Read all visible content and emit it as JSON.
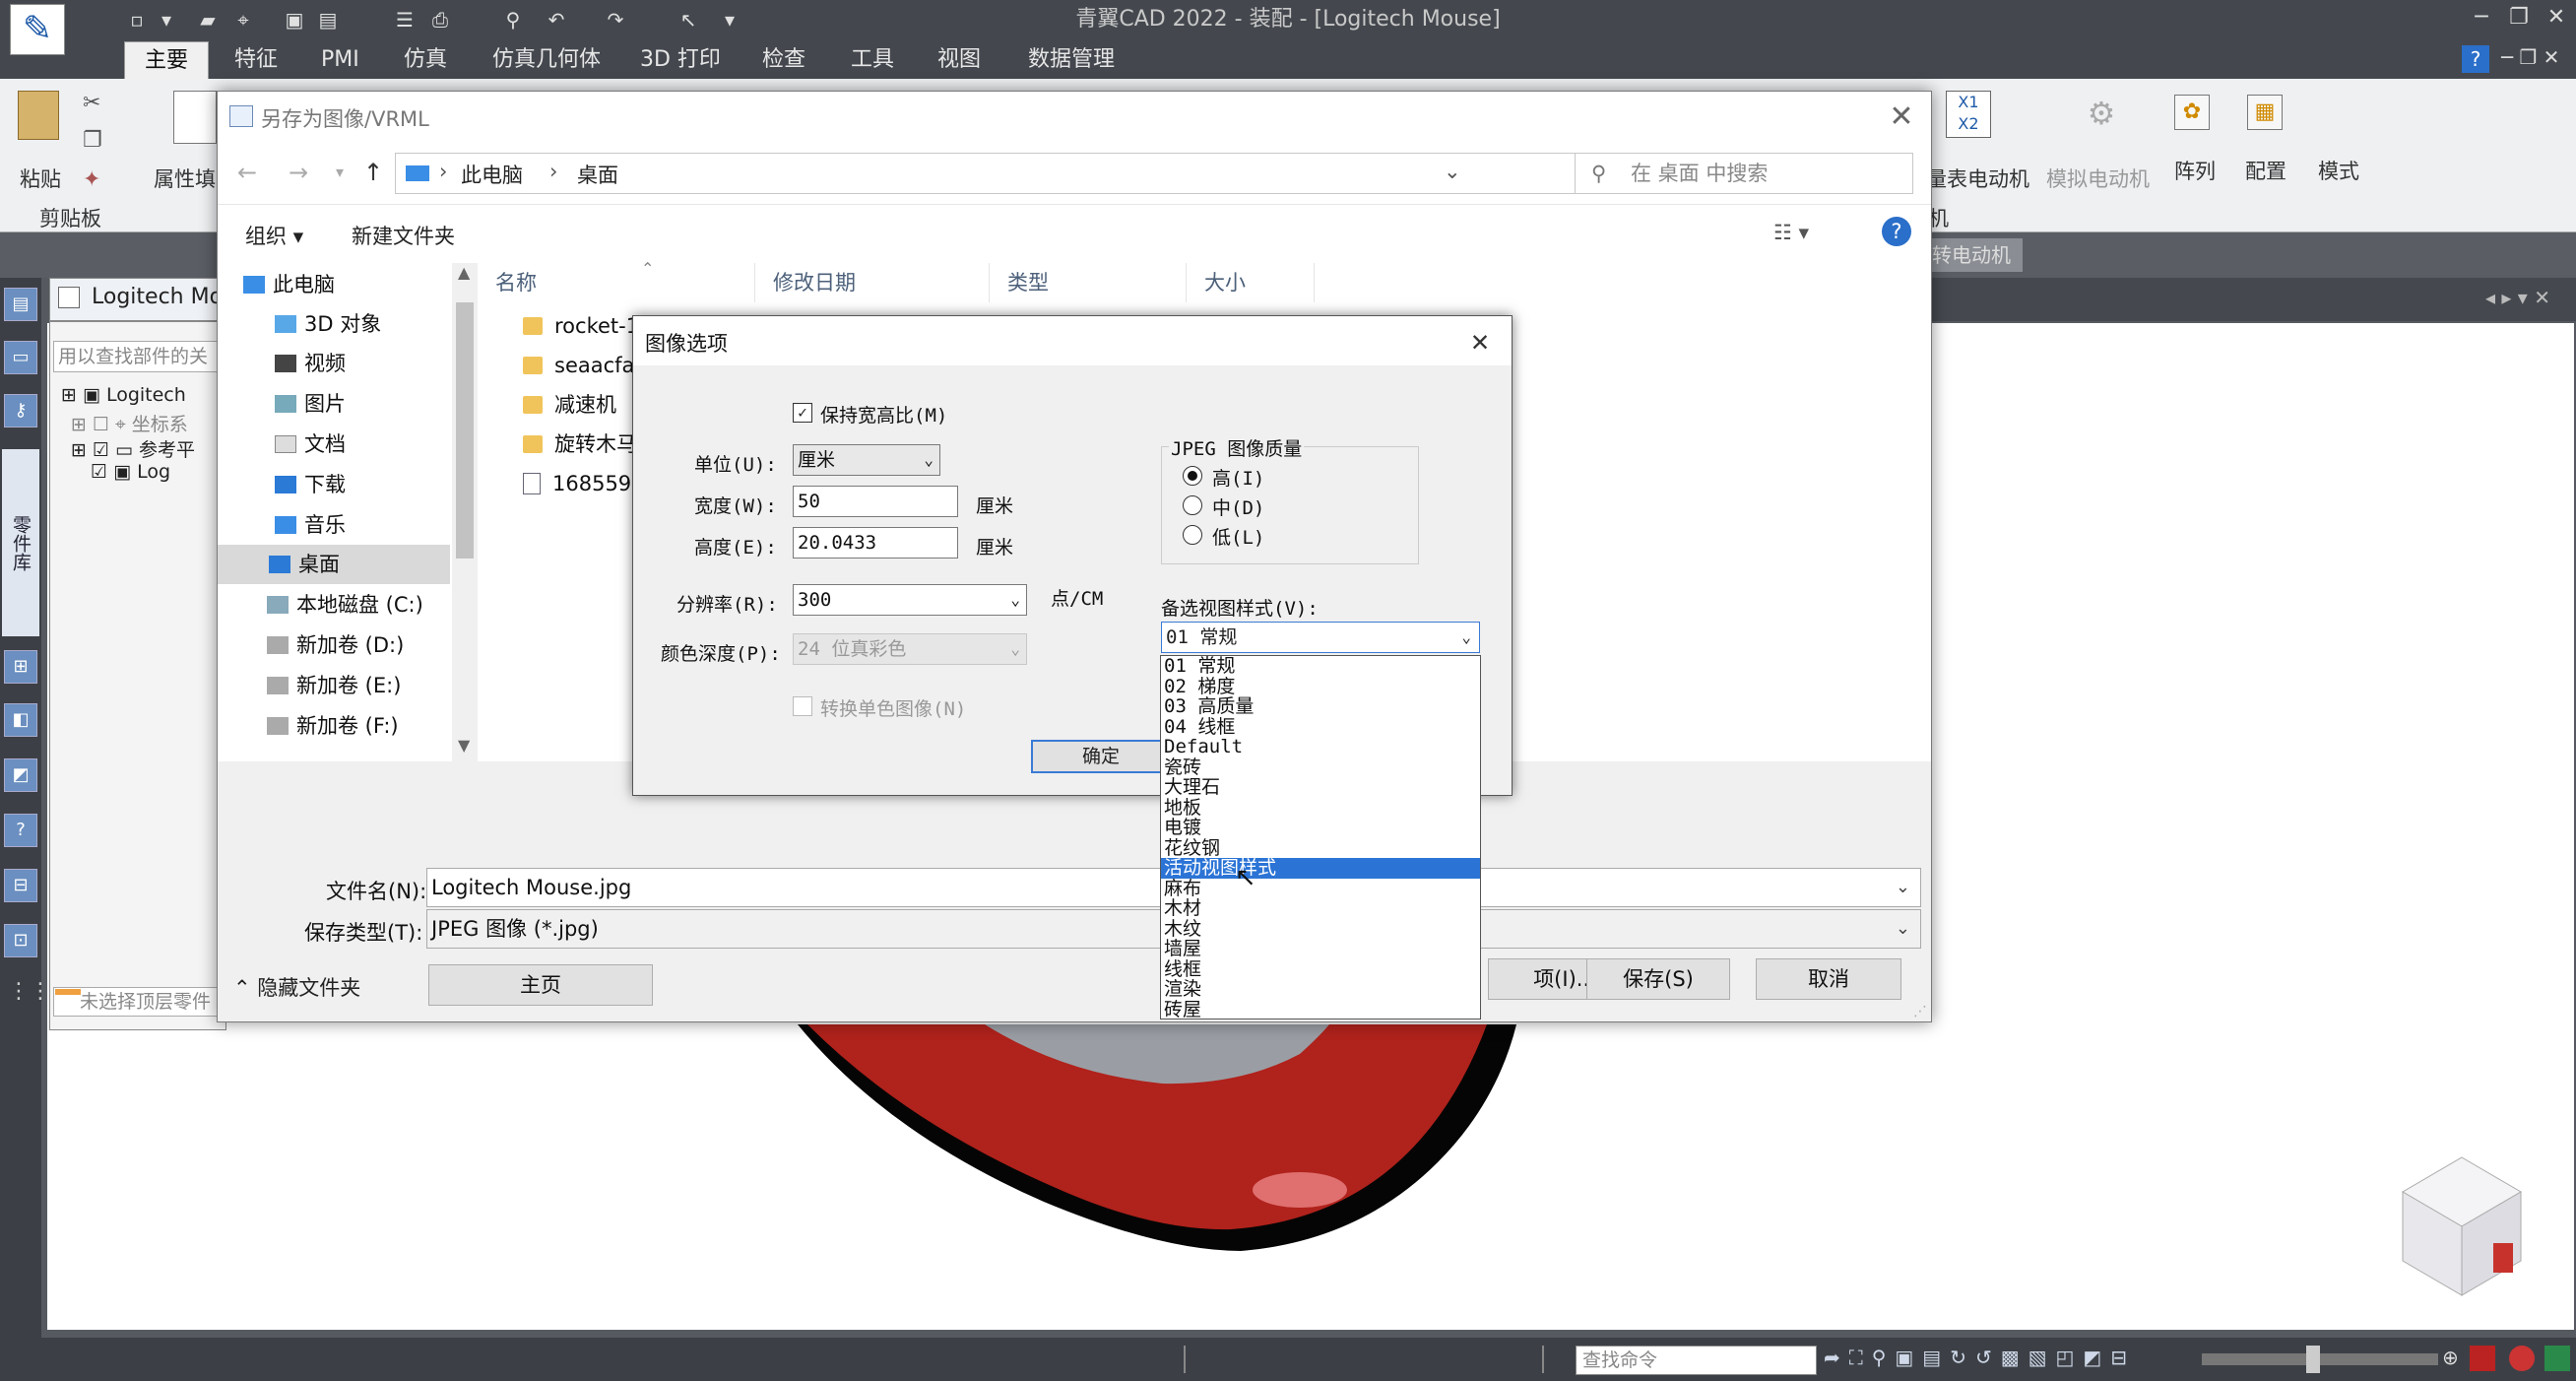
{
  "app": {
    "title": "青翼CAD 2022 - 装配 - [Logitech Mouse]",
    "logo_icon": "feather-logo-icon"
  },
  "ribbon_tabs": [
    "主要",
    "特征",
    "PMI",
    "仿真",
    "仿真几何体",
    "3D 打印",
    "检查",
    "工具",
    "视图",
    "数据管理"
  ],
  "ribbon": {
    "paste": "粘贴",
    "clipboard_group": "剪贴板",
    "properties": "属性填",
    "meter_motor": "量表电动机",
    "sim_motor": "模拟电动机",
    "motor_group": "机",
    "array": "阵列",
    "config": "配置",
    "mode": "模式",
    "motor_tab": "转电动机"
  },
  "doc_tab": "Logitech Mo",
  "part_tree": {
    "search_placeholder": "用以查找部件的关",
    "items": [
      "Logitech",
      "坐标系",
      "参考平",
      "Log"
    ],
    "status": "未选择顶层零件"
  },
  "left_strip_label": "零件库",
  "command_input_placeholder": "查找命令",
  "save_dialog": {
    "title": "另存为图像/VRML",
    "breadcrumb": [
      "此电脑",
      "桌面"
    ],
    "search_placeholder": "在 桌面 中搜索",
    "organize": "组织",
    "new_folder": "新建文件夹",
    "nav_items": [
      "此电脑",
      "3D 对象",
      "视频",
      "图片",
      "文档",
      "下载",
      "音乐",
      "桌面",
      "本地磁盘 (C:)",
      "新加卷 (D:)",
      "新加卷 (E:)",
      "新加卷 (F:)"
    ],
    "columns": [
      "名称",
      "修改日期",
      "类型",
      "大小"
    ],
    "files": [
      "rocket-1",
      "seaacfa",
      "减速机",
      "旋转木马",
      "1685599"
    ],
    "filename_label": "文件名(N):",
    "filename_value": "Logitech Mouse.jpg",
    "filetype_label": "保存类型(T):",
    "filetype_value": "JPEG 图像 (*.jpg)",
    "home_button": "主页",
    "hide_folders": "隐藏文件夹",
    "options_button": "项(I)...",
    "save_button": "保存(S)",
    "cancel_button": "取消"
  },
  "image_options": {
    "title": "图像选项",
    "keep_aspect": "保持宽高比(M)",
    "unit_label": "单位(U):",
    "unit_value": "厘米",
    "width_label": "宽度(W):",
    "width_value": "50",
    "width_unit": "厘米",
    "height_label": "高度(E):",
    "height_value": "20.0433",
    "height_unit": "厘米",
    "resolution_label": "分辨率(R):",
    "resolution_value": "300",
    "resolution_unit": "点/CM",
    "color_depth_label": "颜色深度(P):",
    "color_depth_value": "24 位真彩色",
    "monochrome": "转换单色图像(N)",
    "jpeg_group": "JPEG 图像质量",
    "quality_options": [
      "高(I)",
      "中(D)",
      "低(L)"
    ],
    "view_style_label": "备选视图样式(V):",
    "view_style_value": "01 常规",
    "ok_button": "确定",
    "view_styles": [
      "01 常规",
      "02 梯度",
      "03 高质量",
      "04 线框",
      "Default",
      "瓷砖",
      "大理石",
      "地板",
      "电镀",
      "花纹钢",
      "活动视图样式",
      "麻布",
      "木材",
      "木纹",
      "墙屋",
      "线框",
      "渲染",
      "砖屋"
    ],
    "selected_style_index": 10
  },
  "colors": {
    "accent": "#2b74d6",
    "title_bar": "#44484e",
    "mouse_red": "#b0221c"
  }
}
